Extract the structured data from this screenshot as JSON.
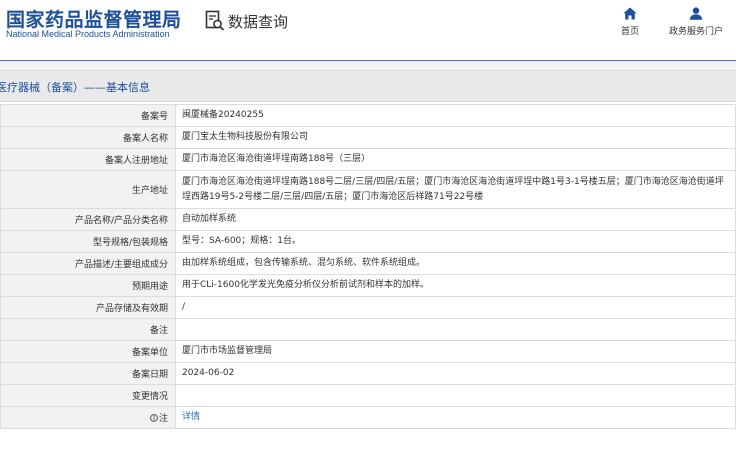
{
  "header": {
    "logo_cn": "国家药品监督管理局",
    "logo_en": "National Medical Products Administration",
    "query_label": "数据查询",
    "nav": [
      {
        "label": "首页",
        "icon": "home-icon"
      },
      {
        "label": "政务服务门户",
        "icon": "user-icon"
      }
    ]
  },
  "section": {
    "title": "医疗器械（备案）——基本信息"
  },
  "rows": [
    {
      "label": "备案号",
      "value": "闽厦械备20240255"
    },
    {
      "label": "备案人名称",
      "value": "厦门宝太生物科技股份有限公司"
    },
    {
      "label": "备案人注册地址",
      "value": "厦门市海沧区海沧街道坪埕南路188号（三层）"
    },
    {
      "label": "生产地址",
      "value": "厦门市海沧区海沧街道坪埕南路188号二层/三层/四层/五层；厦门市海沧区海沧街道坪埕中路1号3-1号楼五层；厦门市海沧区海沧街道坪埕西路19号5-2号楼二层/三层/四层/五层；厦门市海沧区后祥路71号22号楼"
    },
    {
      "label": "产品名称/产品分类名称",
      "value": "自动加样系统"
    },
    {
      "label": "型号规格/包装规格",
      "value": "型号：SA-600；规格：1台。"
    },
    {
      "label": "产品描述/主要组成成分",
      "value": "由加样系统组成，包含传输系统、混匀系统、软件系统组成。"
    },
    {
      "label": "预期用途",
      "value": "用于CLi-1600化学发光免疫分析仪分析前试剂和样本的加样。"
    },
    {
      "label": "产品存储及有效期",
      "value": "/"
    },
    {
      "label": "备注",
      "value": ""
    },
    {
      "label": "备案单位",
      "value": "厦门市市场监督管理局"
    },
    {
      "label": "备案日期",
      "value": "2024-06-02"
    },
    {
      "label": "变更情况",
      "value": ""
    },
    {
      "label": "注",
      "value": "详情",
      "icon": "info-icon"
    }
  ],
  "colors": {
    "brand": "#1d4f9c",
    "link": "#2a6ebb",
    "label_bg": "#f2f2f2"
  }
}
